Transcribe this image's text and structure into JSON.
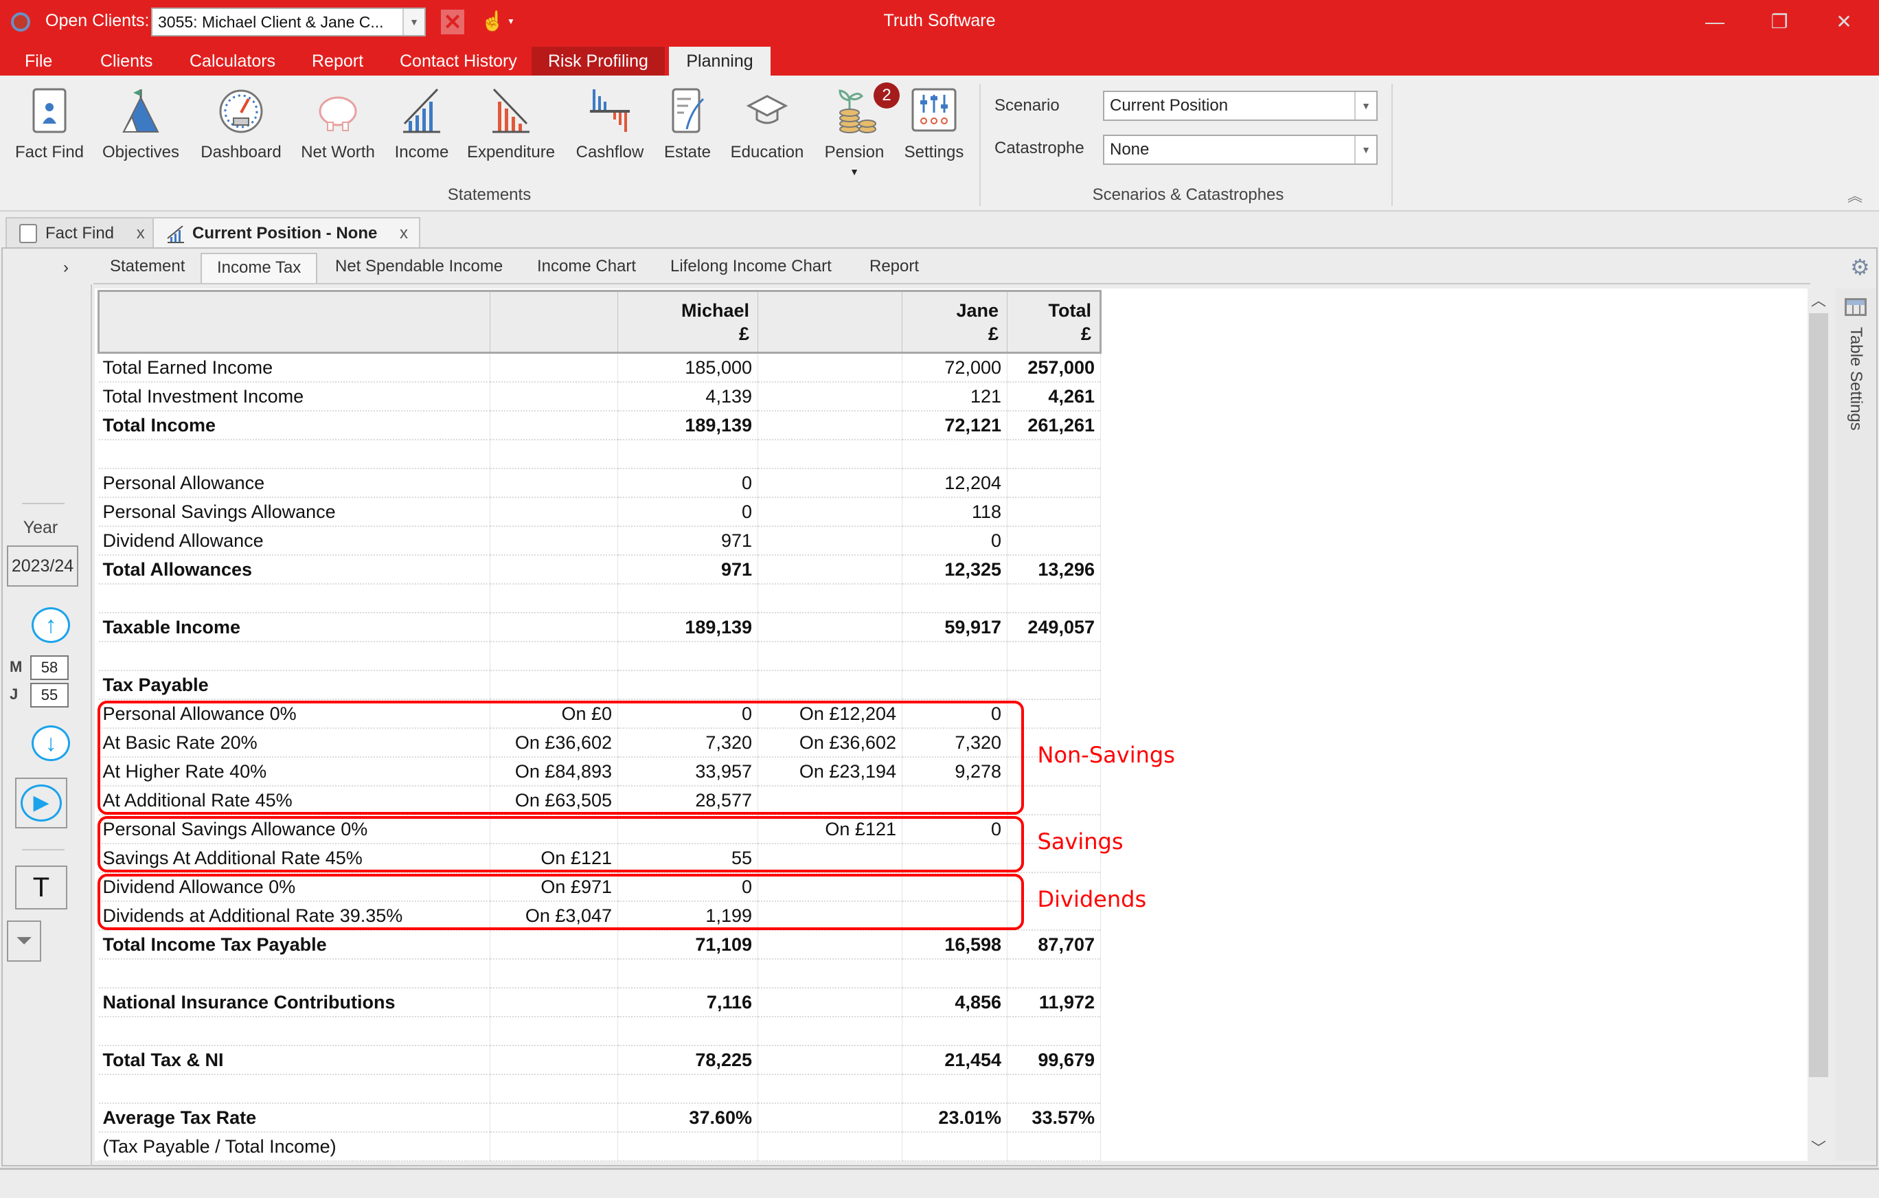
{
  "titlebar": {
    "open_clients_label": "Open Clients:",
    "client_selected": "3055: Michael Client & Jane C...",
    "app_title": "Truth Software",
    "icons": {
      "app": "app-logo-icon",
      "close_client": "close-client-icon",
      "touch": "touch-hand-icon"
    },
    "window_controls": {
      "minimize": "—",
      "maximize": "❐",
      "close": "✕"
    }
  },
  "menu": {
    "tabs": [
      {
        "label": "File"
      },
      {
        "label": "Clients"
      },
      {
        "label": "Calculators"
      },
      {
        "label": "Report"
      },
      {
        "label": "Contact History"
      },
      {
        "label": "Risk Profiling"
      },
      {
        "label": "Planning",
        "active": true
      }
    ]
  },
  "ribbon": {
    "buttons": [
      {
        "label": "Fact Find",
        "icon": "fact-find-icon"
      },
      {
        "label": "Objectives",
        "icon": "objectives-icon"
      },
      {
        "label": "Dashboard",
        "icon": "dashboard-icon"
      },
      {
        "label": "Net Worth",
        "icon": "piggy-bank-icon"
      },
      {
        "label": "Income",
        "icon": "income-chart-icon"
      },
      {
        "label": "Expenditure",
        "icon": "expenditure-chart-icon"
      },
      {
        "label": "Cashflow",
        "icon": "cashflow-icon"
      },
      {
        "label": "Estate",
        "icon": "estate-icon"
      },
      {
        "label": "Education",
        "icon": "graduation-cap-icon"
      },
      {
        "label": "Pension",
        "icon": "pension-icon",
        "badge": "2",
        "dropdown": true
      },
      {
        "label": "Settings",
        "icon": "settings-sliders-icon"
      }
    ],
    "group_statements_label": "Statements",
    "scenario_label": "Scenario",
    "scenario_value": "Current Position",
    "catastrophe_label": "Catastrophe",
    "catastrophe_value": "None",
    "group_scenarios_label": "Scenarios & Catastrophes",
    "colors": {
      "brand_red": "#e21f1f",
      "badge": "#a51c1c"
    }
  },
  "doc_tabs": [
    {
      "label": "Fact Find",
      "close": "x"
    },
    {
      "label": "Current Position - None",
      "close": "x",
      "active": true
    }
  ],
  "sub_tabs": [
    {
      "label": "Statement"
    },
    {
      "label": "Income Tax",
      "active": true
    },
    {
      "label": "Net Spendable Income"
    },
    {
      "label": "Income Chart"
    },
    {
      "label": "Lifelong Income Chart"
    },
    {
      "label": "Report"
    }
  ],
  "sidebar": {
    "toggle": "›",
    "year_label": "Year",
    "year_value": "2023/24",
    "ages": [
      {
        "label": "M",
        "value": "58"
      },
      {
        "label": "J",
        "value": "55"
      }
    ],
    "text_button": "T"
  },
  "table": {
    "headers": [
      "",
      "",
      "Michael\n£",
      "",
      "Jane\n£",
      "Total\n£"
    ],
    "header_michael": "Michael",
    "header_jane": "Jane",
    "header_total": "Total",
    "currency": "£",
    "rows": [
      {
        "cells": [
          "Total Earned Income",
          "",
          "185,000",
          "",
          "72,000",
          "257,000"
        ],
        "total_bold": true
      },
      {
        "cells": [
          "Total Investment Income",
          "",
          "4,139",
          "",
          "121",
          "4,261"
        ],
        "total_bold": true
      },
      {
        "cells": [
          "Total Income",
          "",
          "189,139",
          "",
          "72,121",
          "261,261"
        ],
        "bold": true
      },
      {
        "cells": [
          "",
          "",
          "",
          "",
          "",
          ""
        ],
        "blank": true
      },
      {
        "cells": [
          "Personal Allowance",
          "",
          "0",
          "",
          "12,204",
          ""
        ]
      },
      {
        "cells": [
          "Personal Savings Allowance",
          "",
          "0",
          "",
          "118",
          ""
        ]
      },
      {
        "cells": [
          "Dividend Allowance",
          "",
          "971",
          "",
          "0",
          ""
        ]
      },
      {
        "cells": [
          "Total Allowances",
          "",
          "971",
          "",
          "12,325",
          "13,296"
        ],
        "bold": true
      },
      {
        "cells": [
          "",
          "",
          "",
          "",
          "",
          ""
        ],
        "blank": true
      },
      {
        "cells": [
          "Taxable Income",
          "",
          "189,139",
          "",
          "59,917",
          "249,057"
        ],
        "bold": true
      },
      {
        "cells": [
          "",
          "",
          "",
          "",
          "",
          ""
        ],
        "blank": true
      },
      {
        "cells": [
          "Tax Payable",
          "",
          "",
          "",
          "",
          ""
        ],
        "bold": true
      },
      {
        "cells": [
          "Personal Allowance 0%",
          "On £0",
          "0",
          "On £12,204",
          "0",
          ""
        ]
      },
      {
        "cells": [
          "At Basic Rate 20%",
          "On £36,602",
          "7,320",
          "On £36,602",
          "7,320",
          ""
        ]
      },
      {
        "cells": [
          "At Higher Rate 40%",
          "On £84,893",
          "33,957",
          "On £23,194",
          "9,278",
          ""
        ]
      },
      {
        "cells": [
          "At Additional Rate 45%",
          "On £63,505",
          "28,577",
          "",
          "",
          ""
        ]
      },
      {
        "cells": [
          "Personal Savings Allowance 0%",
          "",
          "",
          "On £121",
          "0",
          ""
        ]
      },
      {
        "cells": [
          "Savings At Additional Rate 45%",
          "On £121",
          "55",
          "",
          "",
          ""
        ]
      },
      {
        "cells": [
          "Dividend Allowance 0%",
          "On £971",
          "0",
          "",
          "",
          ""
        ]
      },
      {
        "cells": [
          "Dividends at Additional Rate 39.35%",
          "On £3,047",
          "1,199",
          "",
          "",
          ""
        ]
      },
      {
        "cells": [
          "Total Income Tax Payable",
          "",
          "71,109",
          "",
          "16,598",
          "87,707"
        ],
        "bold": true
      },
      {
        "cells": [
          "",
          "",
          "",
          "",
          "",
          ""
        ],
        "blank": true
      },
      {
        "cells": [
          "National Insurance Contributions",
          "",
          "7,116",
          "",
          "4,856",
          "11,972"
        ],
        "bold": true
      },
      {
        "cells": [
          "",
          "",
          "",
          "",
          "",
          ""
        ],
        "blank": true
      },
      {
        "cells": [
          "Total Tax & NI",
          "",
          "78,225",
          "",
          "21,454",
          "99,679"
        ],
        "bold": true
      },
      {
        "cells": [
          "",
          "",
          "",
          "",
          "",
          ""
        ],
        "blank": true
      },
      {
        "cells": [
          "Average Tax Rate",
          "",
          "37.60%",
          "",
          "23.01%",
          "33.57%"
        ],
        "bold": true
      },
      {
        "cells": [
          "(Tax Payable / Total Income)",
          "",
          "",
          "",
          "",
          ""
        ]
      }
    ]
  },
  "annotations": [
    {
      "label": "Non-Savings",
      "rows": [
        12,
        15
      ]
    },
    {
      "label": "Savings",
      "rows": [
        16,
        17
      ]
    },
    {
      "label": "Dividends",
      "rows": [
        18,
        19
      ]
    }
  ],
  "table_settings_label": "Table Settings"
}
